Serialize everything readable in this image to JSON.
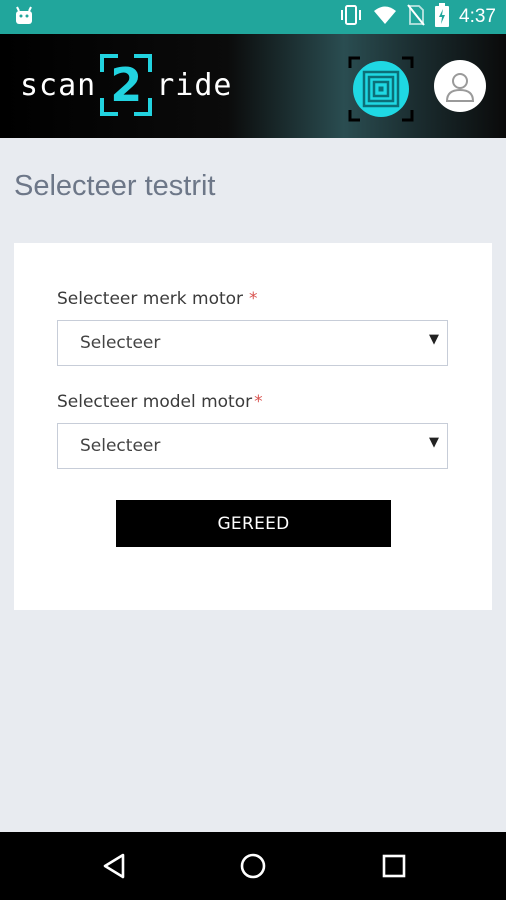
{
  "status_bar": {
    "time": "4:37",
    "icons": [
      "android-icon",
      "vibrate-icon",
      "wifi-icon",
      "no-sim-icon",
      "battery-charging-icon"
    ]
  },
  "header": {
    "logo_left": "scan",
    "logo_mid": "2",
    "logo_right": "ride",
    "accent_color": "#22d3e0",
    "scan_icon": "qr-scan-icon",
    "profile_icon": "user-avatar-icon"
  },
  "page": {
    "title": "Selecteer testrit"
  },
  "form": {
    "brand_label": "Selecteer merk motor",
    "brand_required": "*",
    "brand_value": "Selecteer",
    "model_label": "Selecteer model motor",
    "model_required": "*",
    "model_value": "Selecteer",
    "submit_label": "GEREED"
  },
  "nav": {
    "icons": [
      "back-icon",
      "home-icon",
      "recents-icon"
    ]
  },
  "colors": {
    "status_bar": "#21a69c",
    "background": "#e8ebf0",
    "button": "#000000",
    "required": "#d9534f"
  }
}
